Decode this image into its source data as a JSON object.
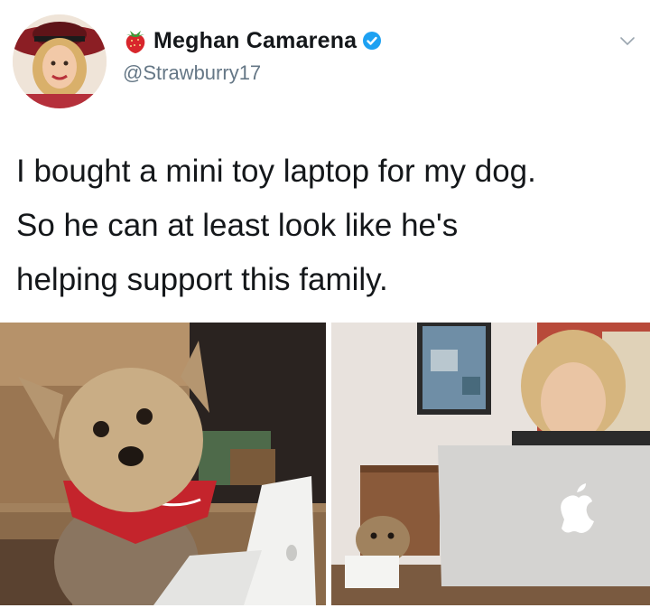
{
  "user": {
    "display_name": "Meghan Camarena",
    "handle": "@Strawburry17",
    "name_emoji_icon": "strawberry-icon",
    "verified_icon": "verified-badge-icon",
    "menu_icon": "chevron-down-icon"
  },
  "tweet": {
    "text_lines": [
      "I bought a mini toy laptop for my dog.",
      "So he can at least look like he's",
      "helping support this family."
    ]
  },
  "media": {
    "left_photo": {
      "subject": "small dog with red bandana beside a mini toy laptop"
    },
    "right_photo": {
      "subject": "woman at a laptop with the dog and its mini laptop at a desk"
    }
  },
  "colors": {
    "text": "#14171a",
    "secondary_text": "#657786",
    "verified": "#1da1f2"
  }
}
